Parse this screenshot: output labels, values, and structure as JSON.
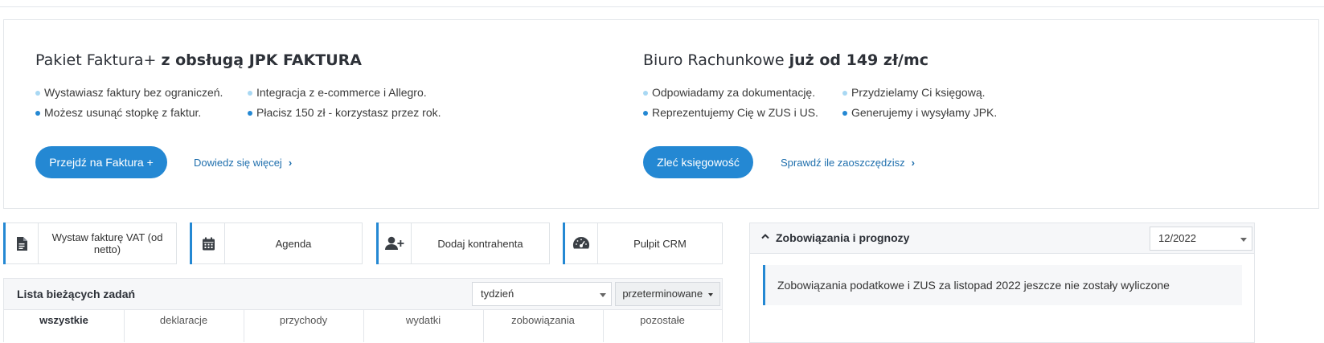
{
  "promo": {
    "left": {
      "title_regular": "Pakiet Faktura+ ",
      "title_bold": "z obsługą JPK FAKTURA",
      "bullets": [
        "Wystawiasz faktury bez ograniczeń.",
        "Integracja z e-commerce i Allegro.",
        "Możesz usunąć stopkę z faktur.",
        "Płacisz 150 zł - korzystasz przez rok."
      ],
      "cta_label": "Przejdź na Faktura +",
      "link_label": "Dowiedz się więcej"
    },
    "right": {
      "title_regular": "Biuro Rachunkowe ",
      "title_bold": "już od 149 zł/mc",
      "bullets": [
        "Odpowiadamy za dokumentację.",
        "Przydzielamy Ci księgową.",
        "Reprezentujemy Cię w ZUS i US.",
        "Generujemy i wysyłamy JPK."
      ],
      "cta_label": "Zleć księgowość",
      "link_label": "Sprawdź ile zaoszczędzisz"
    },
    "colors": {
      "accent": "#2488d3",
      "bullet_light": "#a9d8f3"
    }
  },
  "shortcuts": [
    {
      "label": "Wystaw fakturę VAT (od netto)",
      "icon": "document-icon"
    },
    {
      "label": "Agenda",
      "icon": "calendar-icon"
    },
    {
      "label": "Dodaj kontrahenta",
      "icon": "add-user-icon"
    },
    {
      "label": "Pulpit CRM",
      "icon": "dashboard-gauge-icon"
    }
  ],
  "tasks": {
    "title": "Lista bieżących zadań",
    "period_select": "tydzień",
    "filter_button": "przeterminowane",
    "tabs": [
      "wszystkie",
      "deklaracje",
      "przychody",
      "wydatki",
      "zobowiązania",
      "pozostałe"
    ]
  },
  "obligations": {
    "title": "Zobowiązania i prognozy",
    "month_select": "12/2022",
    "info_text": "Zobowiązania podatkowe i ZUS za listopad 2022 jeszcze nie zostały wyliczone"
  }
}
